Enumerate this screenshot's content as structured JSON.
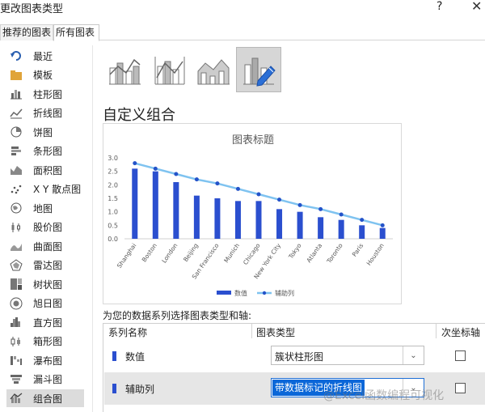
{
  "window": {
    "title": "更改图表类型",
    "help_label": "?",
    "close_label": "✕"
  },
  "tabs": [
    {
      "label": "推荐的图表"
    },
    {
      "label": "所有图表"
    }
  ],
  "sidebar": {
    "items": [
      {
        "label": "最近",
        "icon": "recent-icon"
      },
      {
        "label": "模板",
        "icon": "folder-icon"
      },
      {
        "label": "柱形图",
        "icon": "column-chart-icon"
      },
      {
        "label": "折线图",
        "icon": "line-chart-icon"
      },
      {
        "label": "饼图",
        "icon": "pie-chart-icon"
      },
      {
        "label": "条形图",
        "icon": "bar-chart-icon"
      },
      {
        "label": "面积图",
        "icon": "area-chart-icon"
      },
      {
        "label": "X Y 散点图",
        "icon": "scatter-chart-icon"
      },
      {
        "label": "地图",
        "icon": "map-chart-icon"
      },
      {
        "label": "股价图",
        "icon": "stock-chart-icon"
      },
      {
        "label": "曲面图",
        "icon": "surface-chart-icon"
      },
      {
        "label": "雷达图",
        "icon": "radar-chart-icon"
      },
      {
        "label": "树状图",
        "icon": "treemap-chart-icon"
      },
      {
        "label": "旭日图",
        "icon": "sunburst-chart-icon"
      },
      {
        "label": "直方图",
        "icon": "histogram-chart-icon"
      },
      {
        "label": "箱形图",
        "icon": "box-chart-icon"
      },
      {
        "label": "瀑布图",
        "icon": "waterfall-chart-icon"
      },
      {
        "label": "漏斗图",
        "icon": "funnel-chart-icon"
      },
      {
        "label": "组合图",
        "icon": "combo-chart-icon"
      }
    ],
    "active_index": 18
  },
  "combo_section": {
    "title": "自定义组合",
    "choose_label": "为您的数据系列选择图表类型和轴:"
  },
  "series_table": {
    "headers": {
      "name": "系列名称",
      "type": "图表类型",
      "secondary": "次坐标轴"
    },
    "rows": [
      {
        "name": "数值",
        "type": "簇状柱形图",
        "secondary": false
      },
      {
        "name": "辅助列",
        "type": "带数据标记的折线图",
        "secondary": false
      }
    ]
  },
  "watermark": "@Excel函数编程可视化",
  "colors": {
    "bar": "#2b4fcf",
    "line": "#7fc3f0",
    "marker": "#2453c9",
    "selection": "#0b67d8"
  },
  "chart_data": {
    "type": "bar",
    "title": "图表标题",
    "categories": [
      "Shanghai",
      "Boston",
      "London",
      "Beijing",
      "San Francisco",
      "Munich",
      "Chicago",
      "New York City",
      "Tokyo",
      "Atlanta",
      "Toronto",
      "Paris",
      "Houston"
    ],
    "series": [
      {
        "name": "数值",
        "type": "bar",
        "values": [
          2.6,
          2.5,
          2.1,
          1.6,
          1.5,
          1.4,
          1.4,
          1.1,
          1.0,
          0.8,
          0.7,
          0.5,
          0.4
        ]
      },
      {
        "name": "辅助列",
        "type": "line",
        "values": [
          2.8,
          2.6,
          2.4,
          2.2,
          2.05,
          1.85,
          1.65,
          1.45,
          1.25,
          1.1,
          0.9,
          0.7,
          0.5
        ]
      }
    ],
    "y_ticks": [
      "0.0",
      "0.5",
      "1.0",
      "1.5",
      "2.0",
      "2.5",
      "3.0"
    ],
    "ylim": [
      0,
      3
    ],
    "grid": false,
    "legend_position": "bottom"
  }
}
